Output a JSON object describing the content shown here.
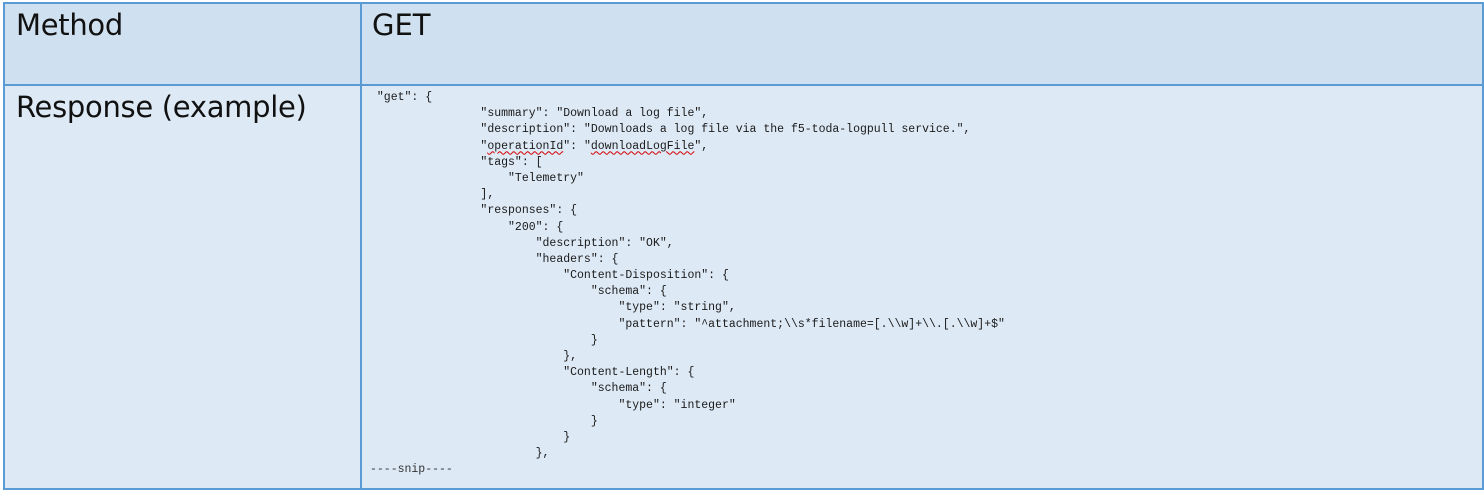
{
  "table": {
    "rows": [
      {
        "label": "Method",
        "value": "GET"
      },
      {
        "label": "Response (example)"
      }
    ]
  },
  "response_code": {
    "lines": [
      " \"get\": {",
      "                \"summary\": \"Download a log file\",",
      "                \"description\": \"Downloads a log file via the f5-toda-logpull service.\",",
      "                \"operationId\": \"downloadLogFile\",",
      "                \"tags\": [",
      "                    \"Telemetry\"",
      "                ],",
      "                \"responses\": {",
      "                    \"200\": {",
      "                        \"description\": \"OK\",",
      "                        \"headers\": {",
      "                            \"Content-Disposition\": {",
      "                                \"schema\": {",
      "                                    \"type\": \"string\",",
      "                                    \"pattern\": \"^attachment;\\\\s*filename=[.\\\\w]+\\\\.[.\\\\w]+$\"",
      "                                }",
      "                            },",
      "                            \"Content-Length\": {",
      "                                \"schema\": {",
      "                                    \"type\": \"integer\"",
      "                                }",
      "                            }",
      "                        },",
      "----snip----"
    ]
  },
  "spellcheck_flagged": [
    "operationId",
    "downloadLogFile"
  ]
}
